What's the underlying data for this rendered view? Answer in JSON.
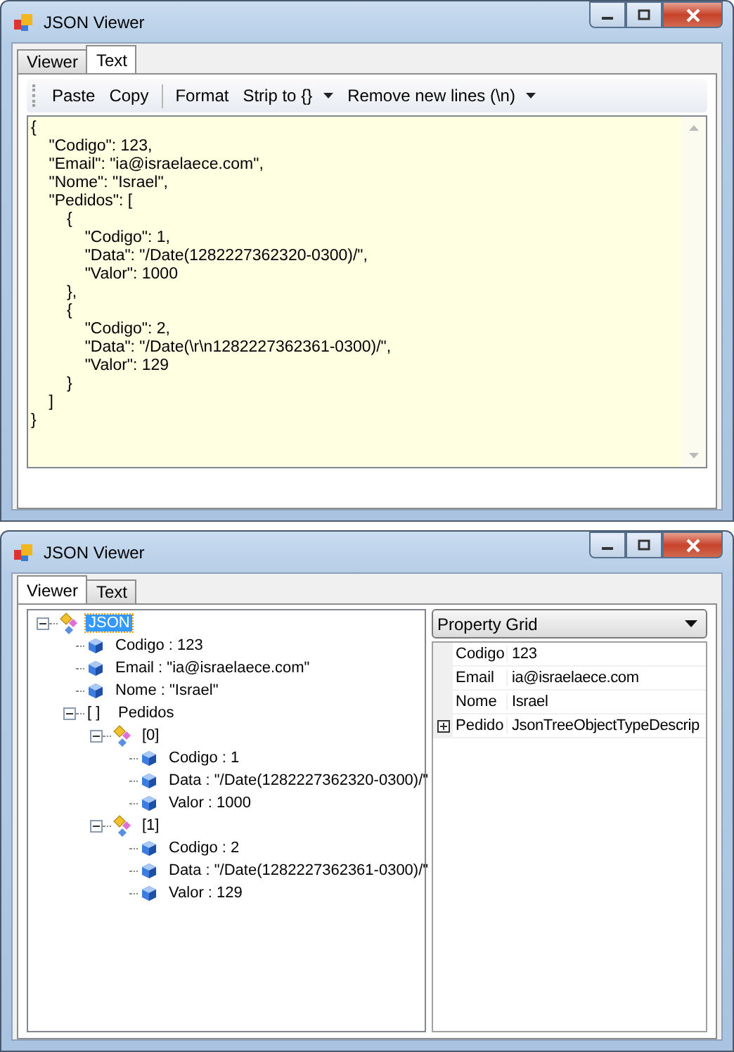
{
  "windows": [
    {
      "title": "JSON Viewer",
      "tabs": [
        {
          "label": "Viewer",
          "selected": false
        },
        {
          "label": "Text",
          "selected": true
        }
      ],
      "toolbar": [
        {
          "kind": "button",
          "label": "Paste"
        },
        {
          "kind": "button",
          "label": "Copy"
        },
        {
          "kind": "separator"
        },
        {
          "kind": "button",
          "label": "Format"
        },
        {
          "kind": "dropdown",
          "label": "Strip to {}"
        },
        {
          "kind": "dropdown",
          "label": "Remove new lines (\\n)"
        }
      ],
      "editor_lines": [
        "{",
        "    \"Codigo\": 123,",
        "    \"Email\": \"ia@israelaece.com\",",
        "    \"Nome\": \"Israel\",",
        "    \"Pedidos\": [",
        "        {",
        "            \"Codigo\": 1,",
        "            \"Data\": \"/Date(1282227362320-0300)/\",",
        "            \"Valor\": 1000",
        "        },",
        "        {",
        "            \"Codigo\": 2,",
        "            \"Data\": \"/Date(\\r\\n1282227362361-0300)/\",",
        "            \"Valor\": 129",
        "        }",
        "    ]",
        "}"
      ]
    },
    {
      "title": "JSON Viewer",
      "tabs": [
        {
          "label": "Viewer",
          "selected": true
        },
        {
          "label": "Text",
          "selected": false
        }
      ],
      "tree": [
        {
          "kind": "object",
          "label": "JSON",
          "selected": true,
          "expanded": true,
          "children": [
            {
              "kind": "value",
              "label": "Codigo : 123",
              "selected": false
            },
            {
              "kind": "value",
              "label": "Email : \"ia@israelaece.com\"",
              "selected": false
            },
            {
              "kind": "value",
              "label": "Nome : \"Israel\"",
              "selected": false
            },
            {
              "kind": "array",
              "glyph": "[ ]",
              "label": "Pedidos",
              "selected": false,
              "expanded": true,
              "children": [
                {
                  "kind": "object",
                  "label": "[0]",
                  "selected": false,
                  "expanded": true,
                  "children": [
                    {
                      "kind": "value",
                      "label": "Codigo : 1",
                      "selected": false
                    },
                    {
                      "kind": "value",
                      "label": "Data : \"/Date(1282227362320-0300)/\"",
                      "selected": false
                    },
                    {
                      "kind": "value",
                      "label": "Valor : 1000",
                      "selected": false
                    }
                  ]
                },
                {
                  "kind": "object",
                  "label": "[1]",
                  "selected": false,
                  "expanded": true,
                  "children": [
                    {
                      "kind": "value",
                      "label": "Codigo : 2",
                      "selected": false
                    },
                    {
                      "kind": "value",
                      "label": "Data : \"/Date(1282227362361-0300)/\"",
                      "selected": false
                    },
                    {
                      "kind": "value",
                      "label": "Valor : 129",
                      "selected": false
                    }
                  ]
                }
              ]
            }
          ]
        }
      ],
      "property_panel": {
        "dropdown": "Property Grid",
        "rows": [
          {
            "name": "Codigo",
            "value": "123",
            "expandable": false
          },
          {
            "name": "Email",
            "value": "ia@israelaece.com",
            "expandable": false
          },
          {
            "name": "Nome",
            "value": "Israel",
            "expandable": false
          },
          {
            "name": "Pedido",
            "value": "JsonTreeObjectTypeDescrip",
            "expandable": true
          }
        ]
      }
    }
  ]
}
